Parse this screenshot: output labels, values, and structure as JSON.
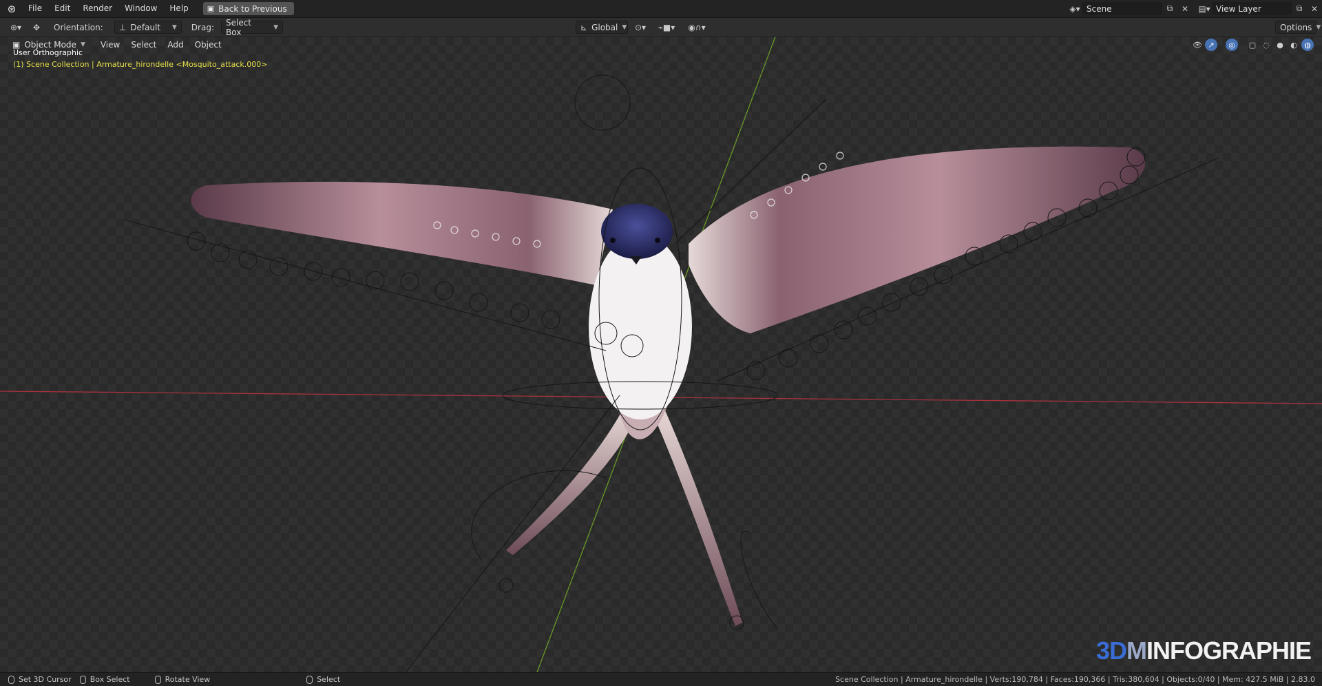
{
  "topbar": {
    "menus": [
      "File",
      "Edit",
      "Render",
      "Window",
      "Help"
    ],
    "back_button": "Back to Previous",
    "scene_name": "Scene",
    "view_layer_name": "View Layer"
  },
  "toolbar": {
    "orientation_label": "Orientation:",
    "orientation_value": "Default",
    "drag_label": "Drag:",
    "drag_value": "Select Box",
    "transform_orientation": "Global",
    "options_label": "Options"
  },
  "viewport": {
    "mode": "Object Mode",
    "menus": [
      "View",
      "Select",
      "Add",
      "Object"
    ],
    "view_name": "User Orthographic",
    "collection_info": "(1) Scene Collection | Armature_hirondelle <Mosquito_attack.000>",
    "watermark": {
      "part1": "3D",
      "part2": "M",
      "part3": "INFOGRAPHIE"
    }
  },
  "statusbar": {
    "hints": [
      "Set 3D Cursor",
      "Box Select",
      "Rotate View",
      "Select"
    ],
    "stats": "Scene Collection | Armature_hirondelle | Verts:190,784 | Faces:190,366 | Tris:380,604 | Objects:0/40 | Mem: 427.5 MiB | 2.83.0"
  },
  "colors": {
    "accent": "#4772b3",
    "x_axis": "#a8323e",
    "y_axis": "#6a9a25",
    "info_text": "#e6e14a"
  }
}
